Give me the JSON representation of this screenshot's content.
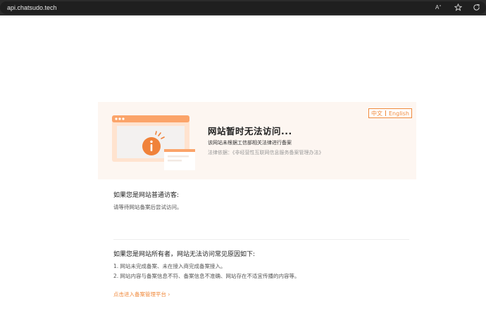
{
  "browser": {
    "url": "api.chatsudo.tech",
    "icons": [
      "read-aloud-icon",
      "favorites-star-icon",
      "refresh-icon"
    ]
  },
  "colors": {
    "accent": "#f08a3c",
    "hero_bg": "#fdf6f1"
  },
  "lang_switch": {
    "zh": "中文",
    "en": "English"
  },
  "hero": {
    "title": "网站暂时无法访问...",
    "desc": "该网站未根据工信部相关法律进行备案",
    "law_prefix": "法律依据：",
    "law_text": "《非经营性互联网信息服务备案管理办法》"
  },
  "visitor": {
    "title": "如果您是网站普通访客:",
    "text": "请等待网站备案后尝试访问。"
  },
  "owner": {
    "title": "如果您是网站所有者，网站无法访问常见原因如下:",
    "items": [
      "1. 网站未完成备案、未在接入商完成备案接入。",
      "2. 网站内容与备案信息不符、备案信息不准确、网站存在不适宜传播的内容等。"
    ]
  },
  "link": {
    "label": "点击进入备案管理平台 ›"
  }
}
